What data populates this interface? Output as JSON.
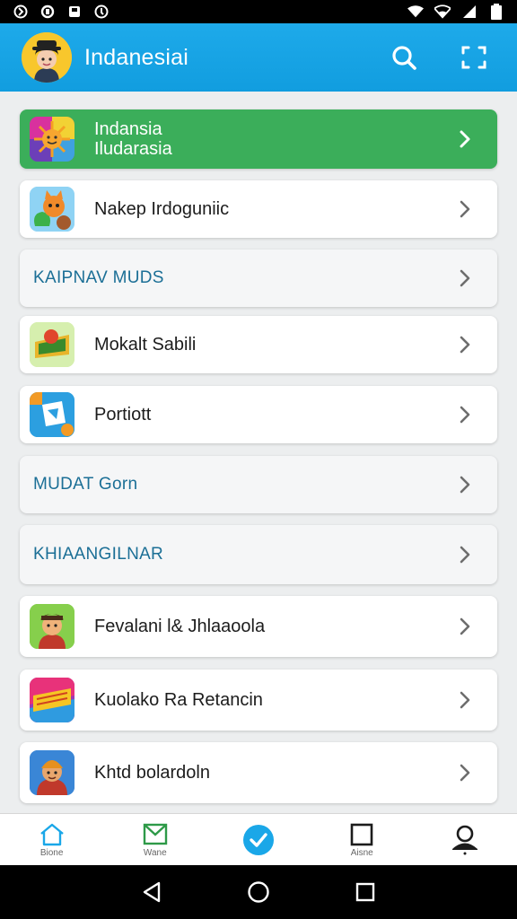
{
  "app": {
    "title": "Indanesiai"
  },
  "colors": {
    "app_bar": "#16a4e6",
    "featured": "#3bae5a",
    "header_text": "#1b6f96",
    "accent_check": "#1aa7e8"
  },
  "list": {
    "featured": {
      "line1": "Indansia",
      "line2": "Iludarasia",
      "icon": "sun-face-icon"
    },
    "rows": [
      {
        "label": "Nakep Irdoguniic",
        "icon": "fox-icon"
      },
      {
        "label": "KAIPNAV MUDS"
      },
      {
        "label": "Mokalt Sabili",
        "icon": "badge-icon"
      },
      {
        "label": "Portiott",
        "icon": "puzzle-icon"
      },
      {
        "label": "MUDAT Gorn"
      },
      {
        "label": "KHIAANGILNAR"
      },
      {
        "label": "Fevalani l& Jhlaaoola",
        "icon": "character-icon"
      },
      {
        "label": "Kuolako Ra Retancin",
        "icon": "logo-game-icon"
      },
      {
        "label": "Khtd bolardoln",
        "icon": "warrior-icon"
      }
    ]
  },
  "bottom_nav": [
    {
      "label": "Bione",
      "icon": "home-icon"
    },
    {
      "label": "Wane",
      "icon": "mail-icon"
    },
    {
      "label": "",
      "icon": "check-circle-icon"
    },
    {
      "label": "Aisne",
      "icon": "square-icon"
    },
    {
      "label": "",
      "icon": "person-icon"
    }
  ]
}
